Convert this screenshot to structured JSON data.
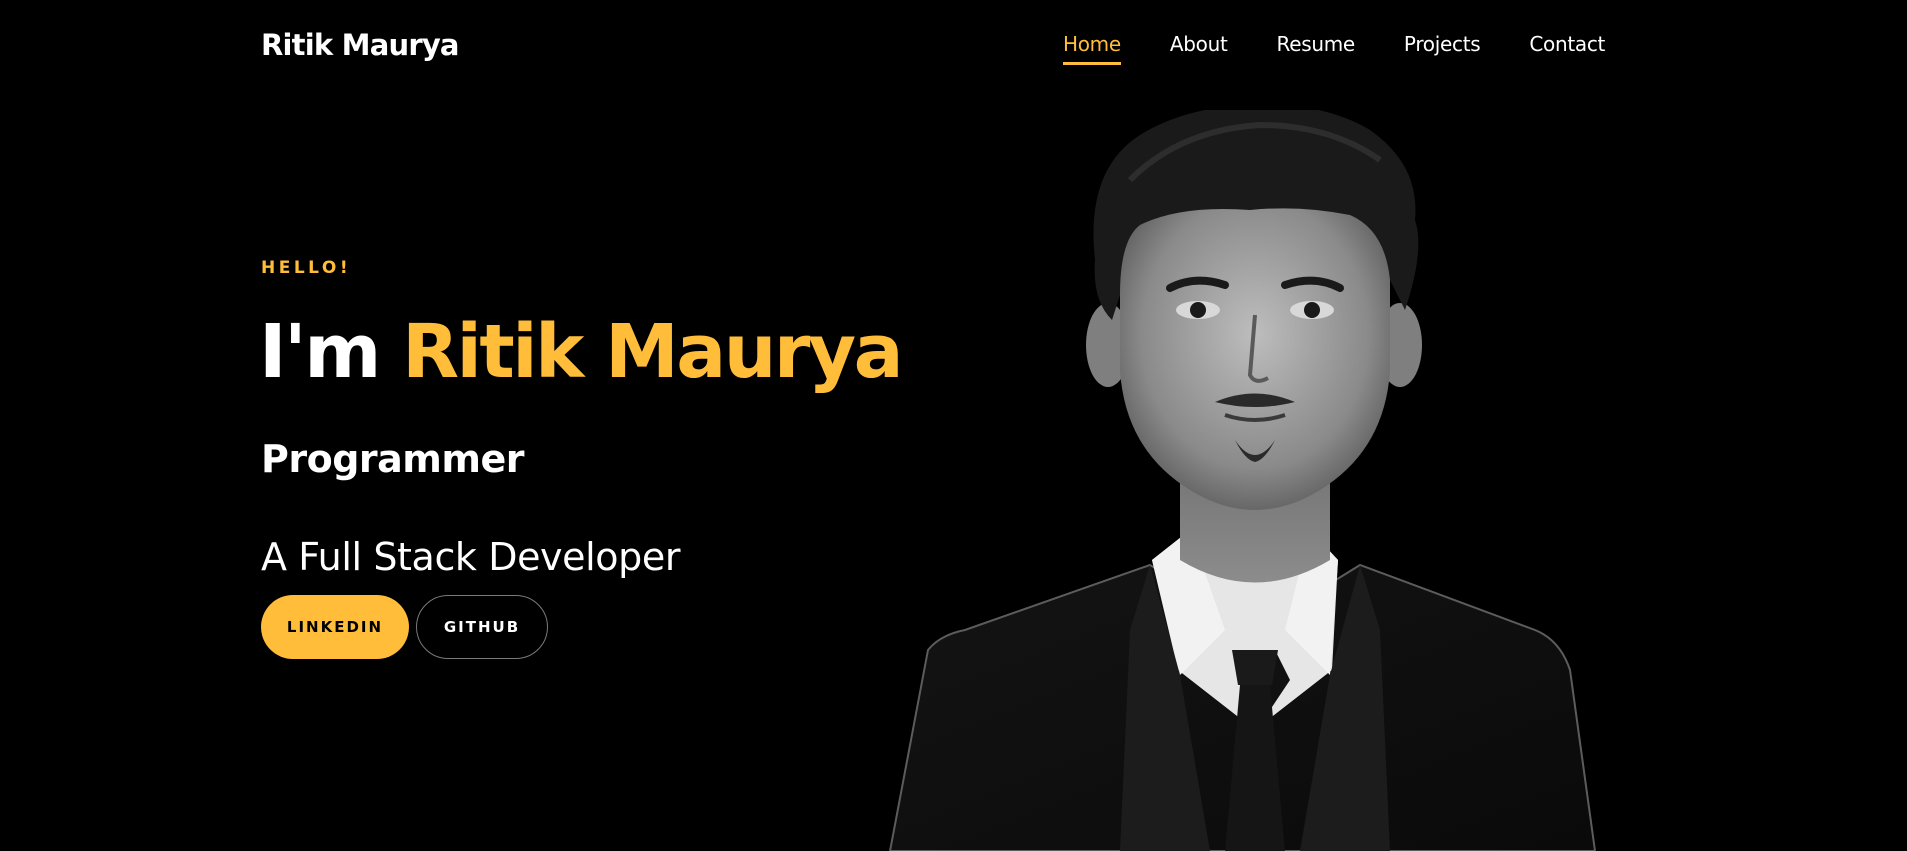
{
  "header": {
    "brand": "Ritik Maurya",
    "nav": [
      {
        "label": "Home",
        "active": true
      },
      {
        "label": "About",
        "active": false
      },
      {
        "label": "Resume",
        "active": false
      },
      {
        "label": "Projects",
        "active": false
      },
      {
        "label": "Contact",
        "active": false
      }
    ]
  },
  "hero": {
    "greeting": "HELLO!",
    "intro": "I'm",
    "name": "Ritik Maurya",
    "role": "Programmer",
    "tagline": "A Full Stack Developer",
    "buttons": {
      "linkedin": "LINKEDIN",
      "github": "GITHUB"
    }
  },
  "colors": {
    "background": "#000000",
    "accent": "#ffbd39",
    "text": "#ffffff"
  }
}
